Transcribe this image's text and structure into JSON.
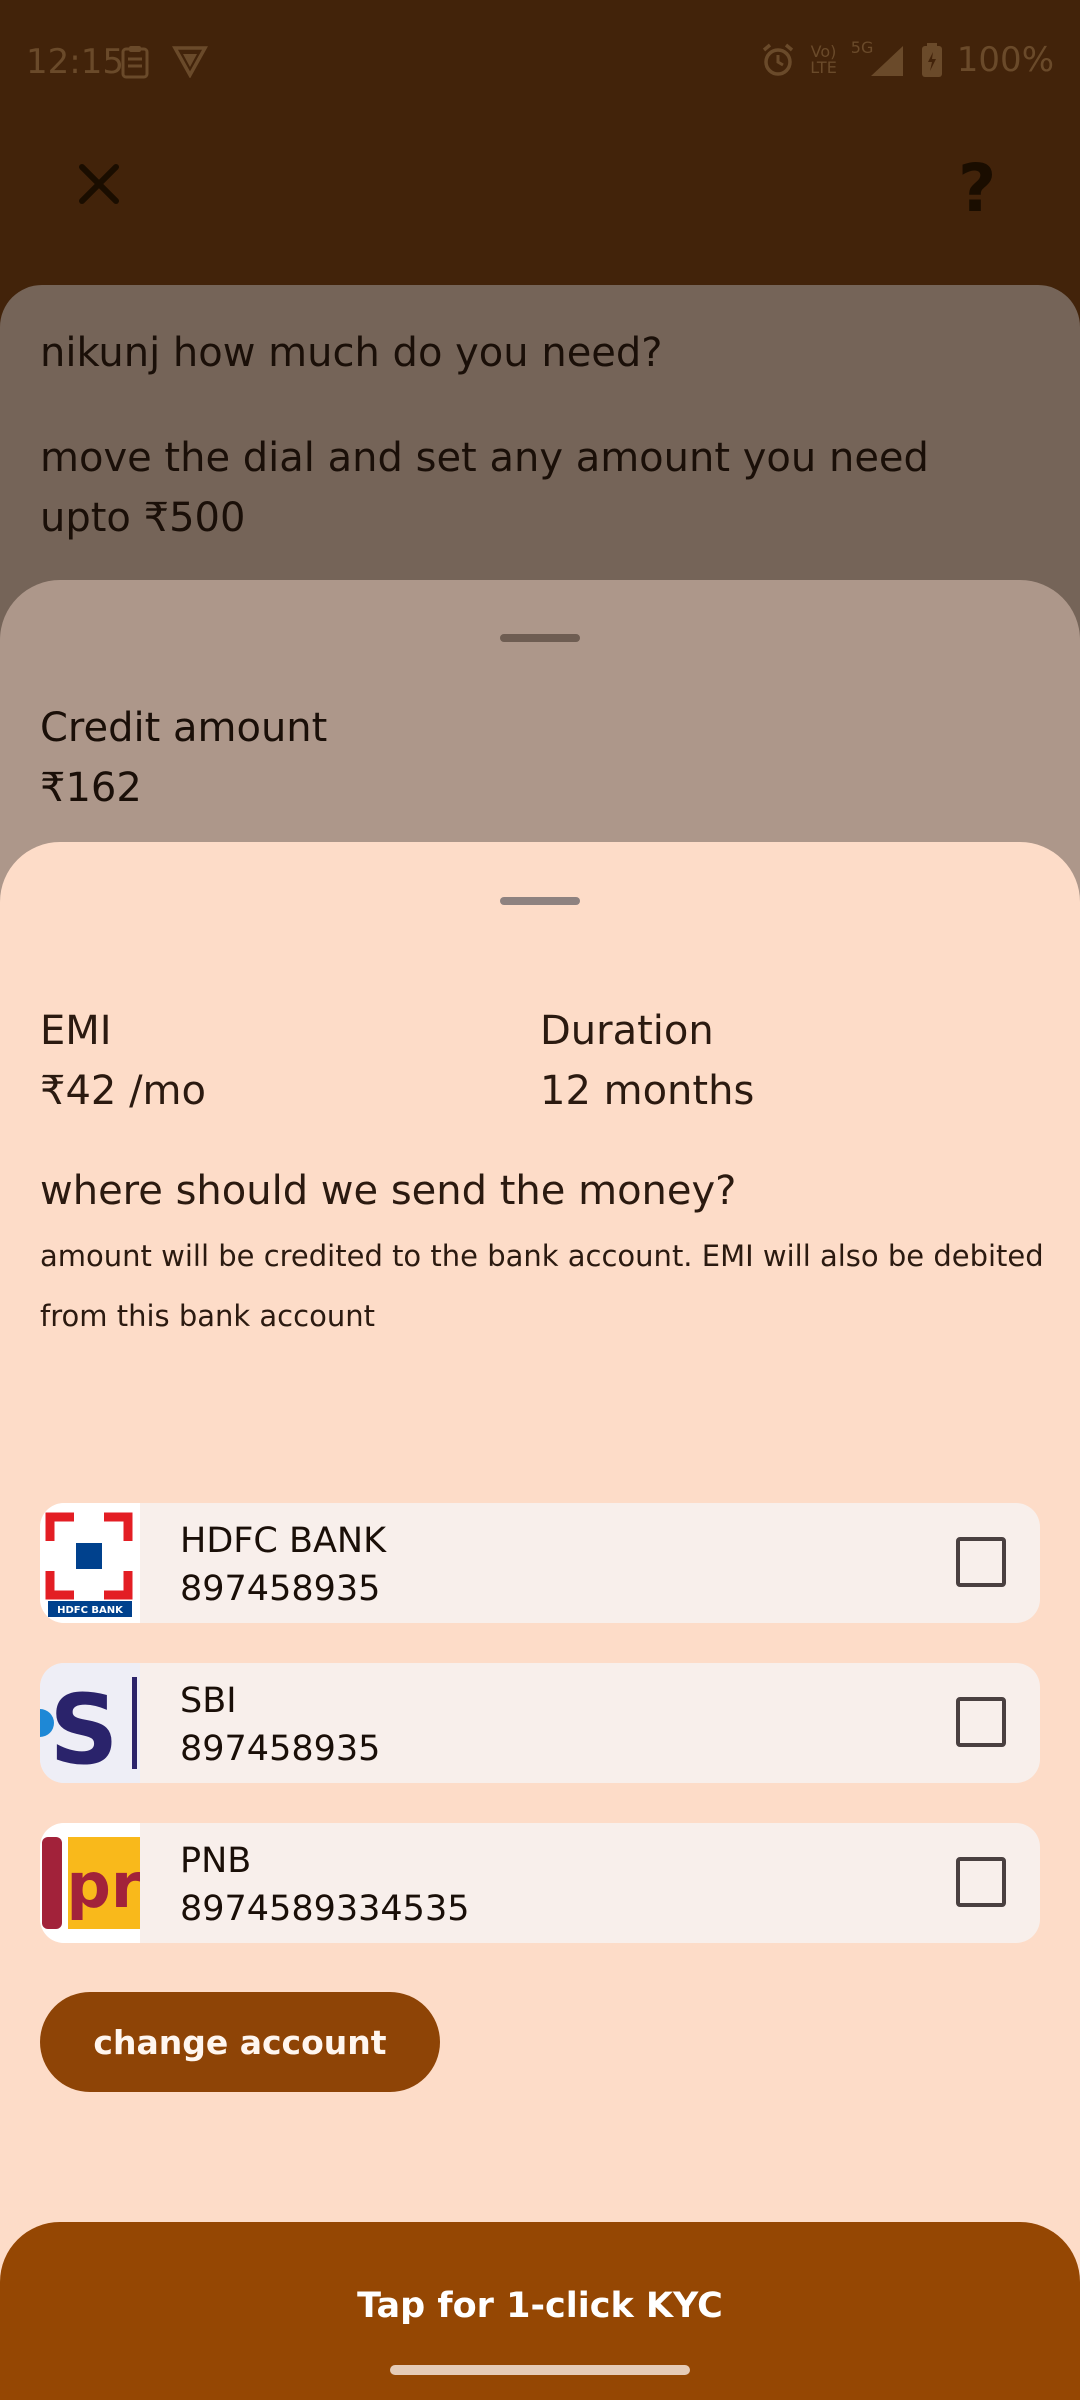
{
  "status_bar": {
    "time": "12:15",
    "network": "5G",
    "volte_top": "Vo)",
    "volte_bottom": "LTE",
    "battery": "100%",
    "icons": [
      "clipboard-icon",
      "vpn-icon",
      "alarm-icon",
      "signal-icon",
      "battery-icon"
    ]
  },
  "header": {
    "help_label": "?"
  },
  "intro_sheet": {
    "question": "nikunj how much do you need?",
    "subtitle": "move the dial and set any amount you need upto ₹500"
  },
  "credit_sheet": {
    "label": "Credit amount",
    "value": "₹162"
  },
  "details_sheet": {
    "emi_label": "EMI",
    "emi_value": "₹42 /mo",
    "duration_label": "Duration",
    "duration_value": "12 months",
    "send_title": "where should we send the money?",
    "send_description": "amount will be credited to the bank account. EMI will also be debited from this bank account"
  },
  "banks": [
    {
      "name": "HDFC BANK",
      "account": "897458935",
      "logo_text": "HDFC BANK",
      "checked": false
    },
    {
      "name": "SBI",
      "account": "897458935",
      "checked": false
    },
    {
      "name": "PNB",
      "account": "8974589334535",
      "checked": false
    }
  ],
  "actions": {
    "change_account": "change account",
    "kyc": "Tap for 1-click KYC"
  },
  "colors": {
    "background": "#42230a",
    "front_sheet": "#fddcc8",
    "primary_button": "#8e4406",
    "kyc_bar": "#954703"
  }
}
